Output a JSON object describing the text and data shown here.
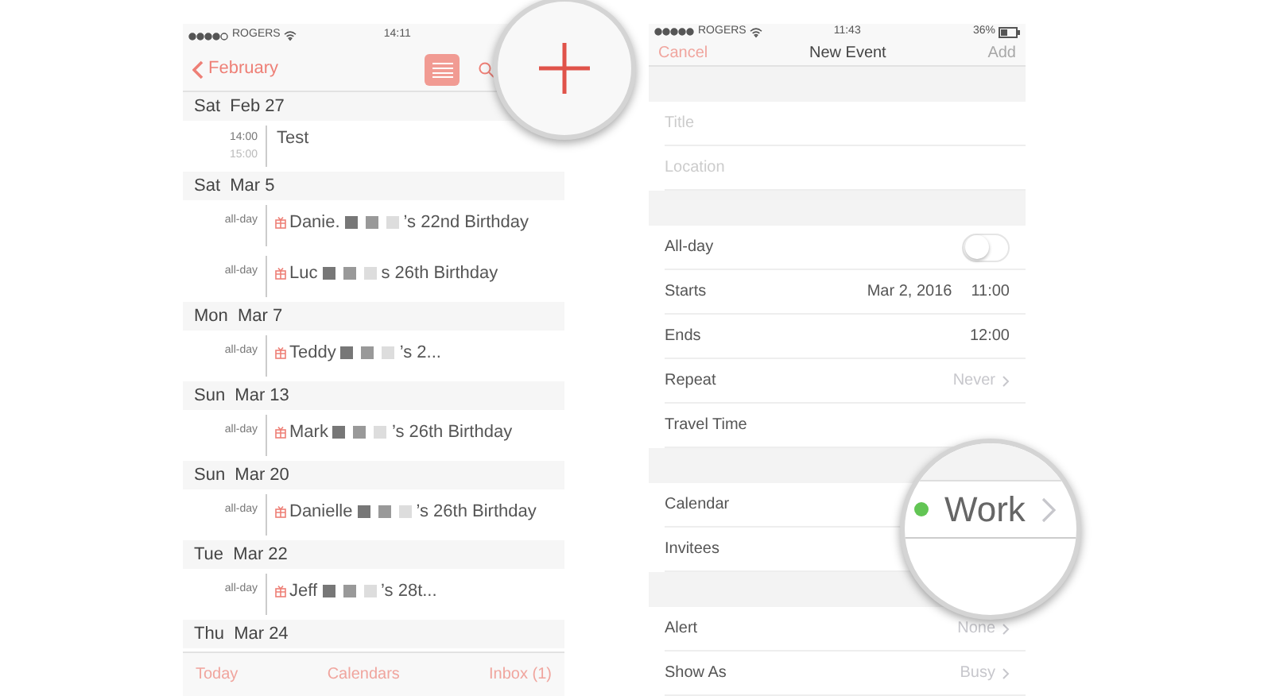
{
  "left_screen": {
    "status_bar": {
      "carrier": "ROGERS",
      "time": "14:11"
    },
    "nav": {
      "back": "February"
    },
    "days": [
      {
        "date": "Sat  Feb 27",
        "events": [
          {
            "kind": "timed",
            "start": "14:00",
            "end": "15:00",
            "title": "Test"
          }
        ]
      },
      {
        "date": "Sat  Mar 5",
        "events": [
          {
            "kind": "birthday",
            "time": "all-day",
            "name": "Danie.",
            "suffix": "’s 22nd Birthday"
          },
          {
            "kind": "birthday",
            "time": "all-day",
            "name": "Luc",
            "suffix": "s 26th Birthday"
          }
        ]
      },
      {
        "date": "Mon  Mar 7",
        "events": [
          {
            "kind": "birthday",
            "time": "all-day",
            "name": "Teddy",
            "suffix": "’s 2..."
          }
        ]
      },
      {
        "date": "Sun  Mar 13",
        "events": [
          {
            "kind": "birthday",
            "time": "all-day",
            "name": "Mark",
            "suffix": "’s 26th Birthday"
          }
        ]
      },
      {
        "date": "Sun  Mar 20",
        "events": [
          {
            "kind": "birthday",
            "time": "all-day",
            "name": "Danielle",
            "suffix": "’s 26th Birthday"
          }
        ]
      },
      {
        "date": "Tue  Mar 22",
        "events": [
          {
            "kind": "birthday",
            "time": "all-day",
            "name": "Jeff",
            "suffix": "’s 28t..."
          }
        ]
      },
      {
        "date": "Thu  Mar 24"
      }
    ],
    "tab_bar": [
      "Today",
      "Calendars",
      "Inbox (1)"
    ]
  },
  "right_screen": {
    "status_bar": {
      "carrier": "ROGERS",
      "time": "11:43",
      "battery": "36%"
    },
    "nav": {
      "cancel": "Cancel",
      "title": "New Event",
      "add": {
        "label": "Add",
        "disabled": true
      }
    },
    "sections": [
      [
        {
          "kind": "field",
          "placeholder": "Title"
        },
        {
          "kind": "field",
          "placeholder": "Location"
        }
      ],
      [
        {
          "kind": "toggle",
          "label": "All-day",
          "on": false
        },
        {
          "kind": "value",
          "label": "Starts",
          "date": "Mar 2, 2016",
          "value": "11:00"
        },
        {
          "kind": "value",
          "label": "Ends",
          "value": "12:00"
        },
        {
          "kind": "link",
          "label": "Repeat",
          "value": "Never"
        },
        {
          "kind": "link",
          "label": "Travel Time"
        }
      ],
      [
        {
          "kind": "calendar",
          "label": "Calendar",
          "value": "Work",
          "color": "#62c554"
        },
        {
          "kind": "link",
          "label": "Invitees"
        }
      ],
      [
        {
          "kind": "link",
          "label": "Alert",
          "value": "None"
        },
        {
          "kind": "link",
          "label": "Show As",
          "value": "Busy"
        }
      ]
    ]
  }
}
